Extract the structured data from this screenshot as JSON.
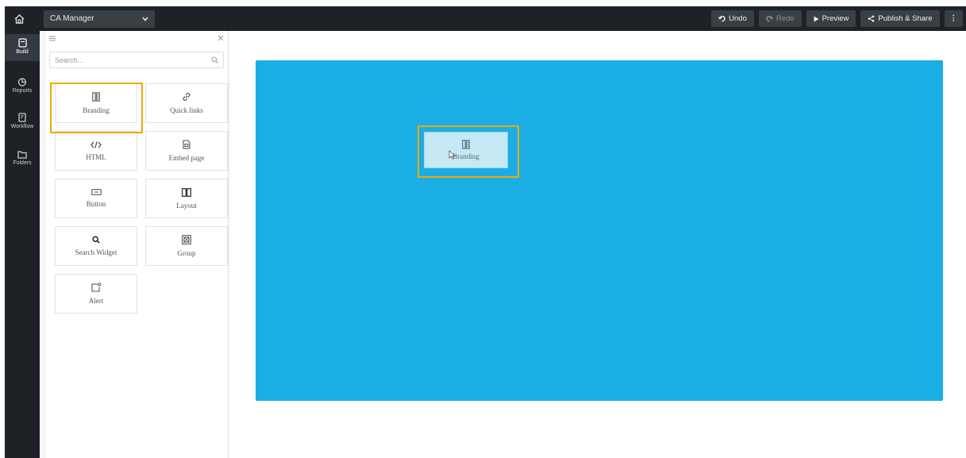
{
  "topbar": {
    "app_name": "CA Manager",
    "undo_label": "Undo",
    "redo_label": "Redo",
    "preview_label": "Preview",
    "publish_label": "Publish & Share",
    "more_label": "⋮"
  },
  "nav": {
    "items": [
      {
        "label": "Build",
        "icon": "build-icon",
        "active": true
      },
      {
        "label": "Reports",
        "icon": "reports-icon"
      },
      {
        "label": "Workflow",
        "icon": "workflow-icon"
      },
      {
        "label": "Folders",
        "icon": "folder-icon"
      }
    ]
  },
  "panel": {
    "search_placeholder": "Search...",
    "widgets": [
      {
        "label": "Branding",
        "icon": "branding-icon",
        "highlighted": true
      },
      {
        "label": "Quick links",
        "icon": "link-icon"
      },
      {
        "label": "HTML",
        "icon": "code-icon"
      },
      {
        "label": "Embed page",
        "icon": "embed-page-icon"
      },
      {
        "label": "Button",
        "icon": "button-icon"
      },
      {
        "label": "Layout",
        "icon": "layout-icon"
      },
      {
        "label": "Search Widget",
        "icon": "search-icon"
      },
      {
        "label": "Group",
        "icon": "group-icon"
      },
      {
        "label": "Alert",
        "icon": "alert-icon"
      }
    ]
  },
  "canvas": {
    "background_color": "#1baee5",
    "drag_ghost_label": "Branding"
  },
  "colors": {
    "highlight": "#f0a800",
    "topbar": "#1e2226"
  }
}
